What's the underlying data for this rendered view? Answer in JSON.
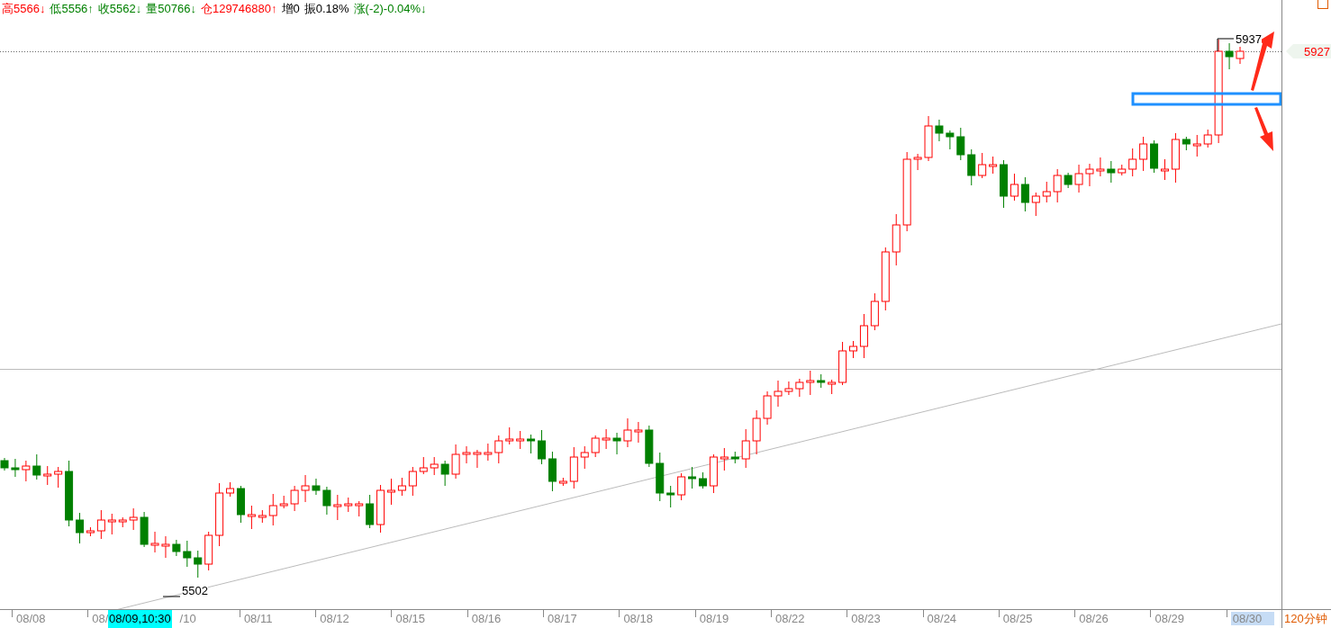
{
  "info_bar": [
    {
      "label": "高",
      "value": "5566",
      "arrow": "↓",
      "color": "#ff0000"
    },
    {
      "label": "低",
      "value": "5556",
      "arrow": "↑",
      "color": "#008000"
    },
    {
      "label": "收",
      "value": "5562",
      "arrow": "↓",
      "color": "#008000"
    },
    {
      "label": "量",
      "value": "50766",
      "arrow": "↓",
      "color": "#008000"
    },
    {
      "label": "仓",
      "value": "129746880",
      "arrow": "↑",
      "color": "#ff0000"
    },
    {
      "label": "增",
      "value": "0",
      "color": "#000000"
    },
    {
      "label": "振",
      "value": "0.18%",
      "color": "#000000"
    },
    {
      "label": "涨",
      "value": "(-2)-0.04%",
      "arrow": "↓",
      "color": "#008000"
    }
  ],
  "chart": {
    "high_label": "5937",
    "low_label": "5502",
    "price_tag": "5927"
  },
  "time_axis": {
    "cursor_label": "08/09,10:30",
    "period": "120分钟",
    "labels": [
      {
        "text": "08/08",
        "kind": "full",
        "highlighted": false
      },
      {
        "text": "08/",
        "kind": "head",
        "highlighted": false
      },
      {
        "text": "/10",
        "kind": "tail",
        "highlighted": false
      },
      {
        "text": "08/11",
        "kind": "full",
        "highlighted": false
      },
      {
        "text": "08/12",
        "kind": "full",
        "highlighted": false
      },
      {
        "text": "08/15",
        "kind": "full",
        "highlighted": false
      },
      {
        "text": "08/16",
        "kind": "full",
        "highlighted": false
      },
      {
        "text": "08/17",
        "kind": "full",
        "highlighted": false
      },
      {
        "text": "08/18",
        "kind": "full",
        "highlighted": false
      },
      {
        "text": "08/19",
        "kind": "full",
        "highlighted": false
      },
      {
        "text": "08/22",
        "kind": "full",
        "highlighted": false
      },
      {
        "text": "08/23",
        "kind": "full",
        "highlighted": false
      },
      {
        "text": "08/24",
        "kind": "full",
        "highlighted": false
      },
      {
        "text": "08/25",
        "kind": "full",
        "highlighted": false
      },
      {
        "text": "08/26",
        "kind": "full",
        "highlighted": false
      },
      {
        "text": "08/29",
        "kind": "full",
        "highlighted": false
      },
      {
        "text": "08/30",
        "kind": "full",
        "highlighted": true
      }
    ]
  }
}
